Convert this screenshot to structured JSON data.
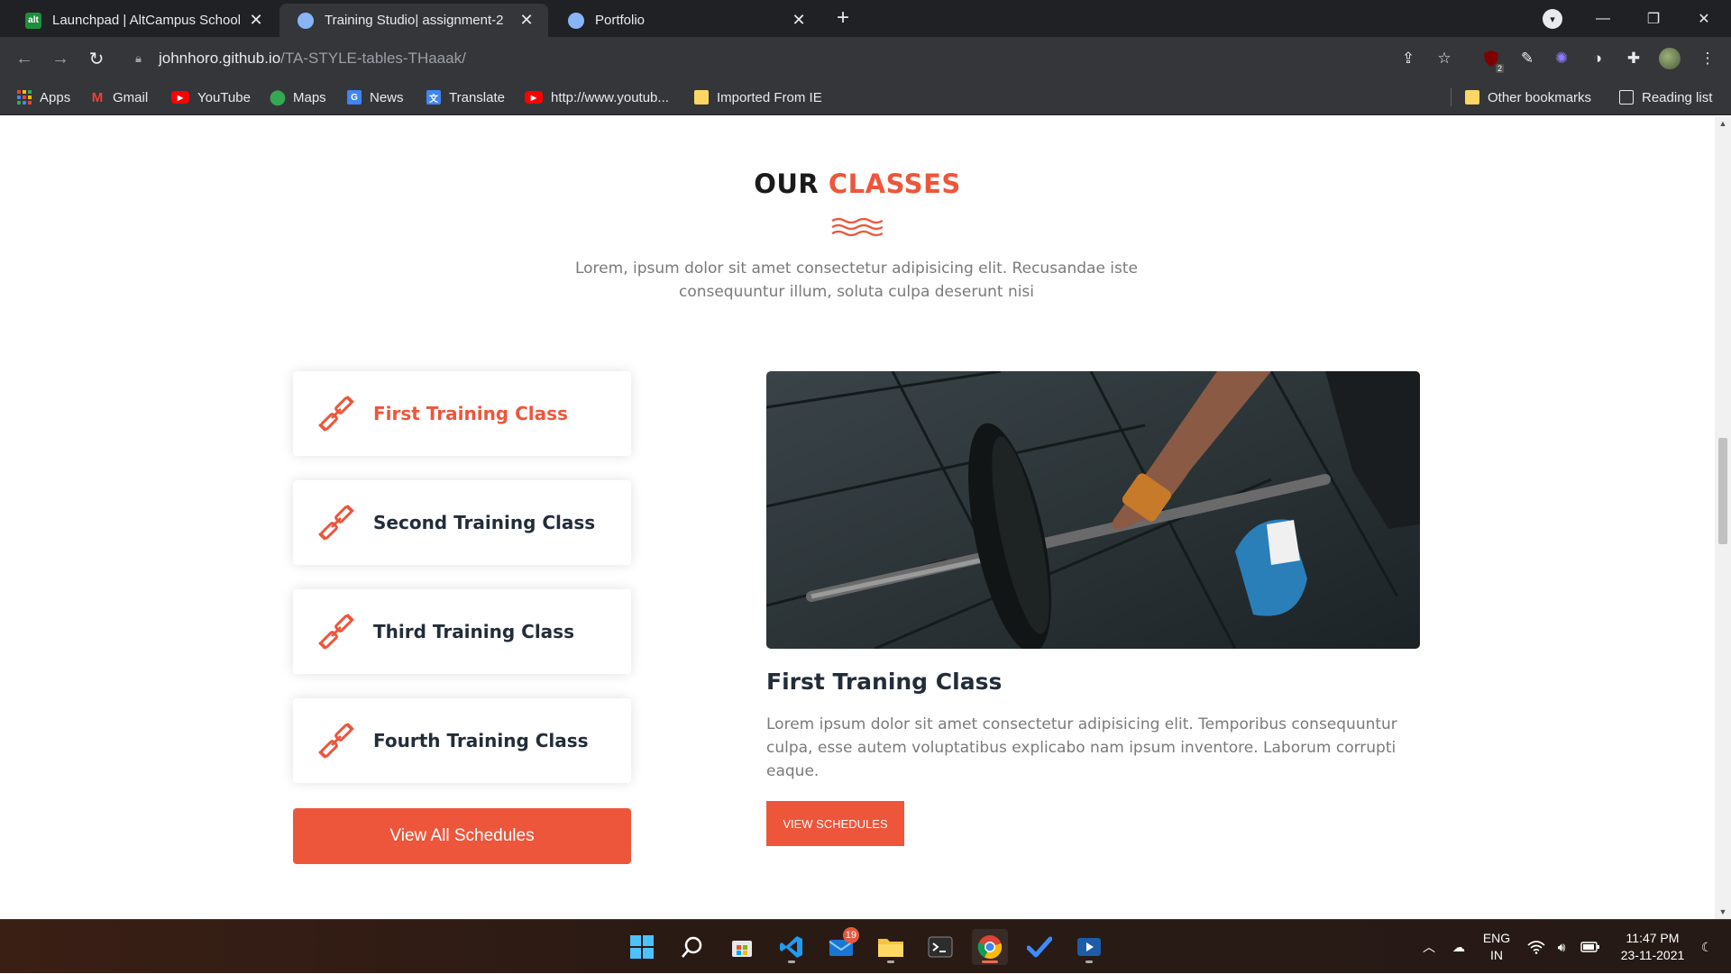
{
  "browser": {
    "tabs": [
      {
        "title": "Launchpad | AltCampus School - ",
        "favicon": "altcampus-icon",
        "active": false
      },
      {
        "title": "Training Studio| assignment-2",
        "favicon": "globe-icon",
        "active": true
      },
      {
        "title": "Portfolio",
        "favicon": "globe-icon",
        "active": false
      }
    ],
    "new_tab_label": "+",
    "url_host": "johnhoro.github.io",
    "url_path": "/TA-STYLE-tables-THaaak/",
    "extension_badge": "2",
    "bookmarks": [
      {
        "label": "Apps",
        "icon": "apps-grid-icon"
      },
      {
        "label": "Gmail",
        "icon": "gmail-icon"
      },
      {
        "label": "YouTube",
        "icon": "youtube-icon"
      },
      {
        "label": "Maps",
        "icon": "maps-icon"
      },
      {
        "label": "News",
        "icon": "news-icon"
      },
      {
        "label": "Translate",
        "icon": "translate-icon"
      },
      {
        "label": "http://www.youtub...",
        "icon": "youtube-icon"
      },
      {
        "label": "Imported From IE",
        "icon": "folder-icon"
      }
    ],
    "other_bookmarks": "Other bookmarks",
    "reading_list": "Reading list"
  },
  "page": {
    "title_main": "OUR",
    "title_accent": "CLASSES",
    "description": "Lorem, ipsum dolor sit amet consectetur adipisicing elit. Recusandae iste consequuntur illum, soluta culpa deserunt nisi",
    "classes": [
      {
        "name": "First Training Class",
        "active": true
      },
      {
        "name": "Second Training Class",
        "active": false
      },
      {
        "name": "Third Training Class",
        "active": false
      },
      {
        "name": "Fourth Training Class",
        "active": false
      }
    ],
    "view_all_label": "View All Schedules",
    "detail": {
      "title": "First Traning Class",
      "description": "Lorem ipsum dolor sit amet consectetur adipisicing elit. Temporibus consequuntur culpa, esse autem voluptatibus explicabo nam ipsum inventore. Laborum corrupti eaque.",
      "button_label": "VIEW SCHEDULES"
    }
  },
  "colors": {
    "accent": "#ed563b",
    "dark": "#232d39",
    "muted": "#7a7a7a"
  },
  "taskbar": {
    "apps": [
      "windows-start-icon",
      "search-icon",
      "store-icon",
      "vscode-icon",
      "mail-icon",
      "file-explorer-icon",
      "terminal-icon",
      "chrome-icon",
      "todo-icon",
      "media-player-icon"
    ],
    "mail_badge": "19",
    "language": "ENG",
    "region": "IN",
    "time": "11:47 PM",
    "date": "23-11-2021"
  }
}
